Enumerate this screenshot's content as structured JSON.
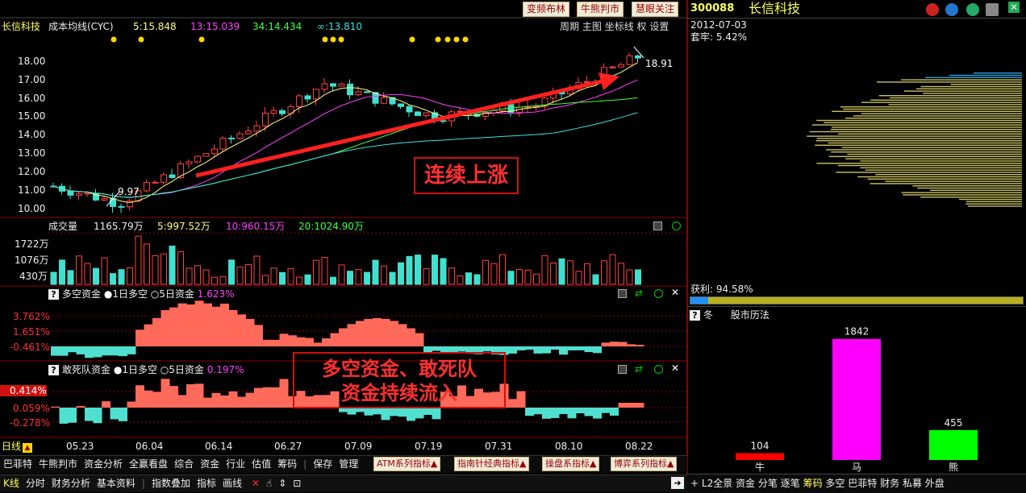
{
  "toolbar": {
    "btn1": "变频布林",
    "btn2": "牛熊判市",
    "btn3": "慧眼关注"
  },
  "main": {
    "stock_name": "长信科技",
    "indicator": "成本均线(CYC)",
    "ma1": "5:15.848",
    "ma2": "13:15.039",
    "ma3": "34:14.434",
    "ma4": "∞:13.810",
    "right_menu": [
      "周期",
      "主图",
      "坐标线",
      "权",
      "设置"
    ],
    "y_ticks": [
      "18.00",
      "17.00",
      "16.00",
      "15.00",
      "14.00",
      "13.00",
      "12.00",
      "11.00",
      "10.00"
    ],
    "high_label": "18.91",
    "low_label": "9.97",
    "annotation": "连续上涨",
    "colors": {
      "up": "#ff4040",
      "down": "#40e0d0",
      "ma5": "#ffff80",
      "ma13": "#ff40ff",
      "ma34": "#40ff40",
      "ma_inf": "#40e0e0"
    }
  },
  "volume": {
    "title": "成交量",
    "v": "1165.79万",
    "m5": "5:997.52万",
    "m10": "10:960.15万",
    "m20": "20:1024.90万",
    "ticks": [
      "1722万",
      "1076万",
      "430万"
    ]
  },
  "panel1": {
    "title": "多空资金",
    "opt1": "1日多空",
    "opt2": "5日资金",
    "value": "1.623%",
    "ticks": [
      "3.762%",
      "1.651%",
      "-0.461%"
    ]
  },
  "panel2": {
    "title": "敢死队资金",
    "opt1": "1日多空",
    "opt2": "5日资金",
    "value": "0.197%",
    "ticks": [
      "0.414%",
      "0.059%",
      "-0.278%"
    ],
    "annotation_line1": "多空资金、敢死队",
    "annotation_line2": "资金持续流入"
  },
  "xaxis": {
    "label": "日线",
    "dates": [
      "05.23",
      "06.04",
      "06.14",
      "06.27",
      "07.09",
      "07.19",
      "07.31",
      "08.10",
      "08.22"
    ]
  },
  "bottom_menu1": [
    "巴菲特",
    "牛熊判市",
    "资金分析",
    "全赢看盘",
    "综合",
    "资金",
    "行业",
    "估值",
    "筹码",
    "保存",
    "管理"
  ],
  "sys_buttons": [
    "ATM系列指标",
    "指南针经典指标",
    "操盘系指标",
    "博弈系列指标"
  ],
  "bottom_menu2": [
    "K线",
    "分时",
    "财务分析",
    "基本资料",
    "指数叠加",
    "指标",
    "画线"
  ],
  "right_panel": {
    "code": "300088",
    "name": "长信科技",
    "date": "2012-07-03",
    "trapped": "套牢: 5.42%",
    "profit": "获利: 94.58%",
    "profit_pct": 94.58,
    "section_title": "冬",
    "section_label": "股市历法"
  },
  "chart_data": {
    "type": "bar",
    "categories": [
      "牛",
      "马",
      "熊"
    ],
    "values": [
      104,
      1842,
      455
    ],
    "colors": [
      "#ff0000",
      "#ff00ff",
      "#00ff00"
    ]
  },
  "right_bottom_menu": [
    "L2全景",
    "资金",
    "分笔",
    "逐笔",
    "筹码",
    "多空",
    "巴菲特",
    "财务",
    "私募",
    "外盘"
  ]
}
